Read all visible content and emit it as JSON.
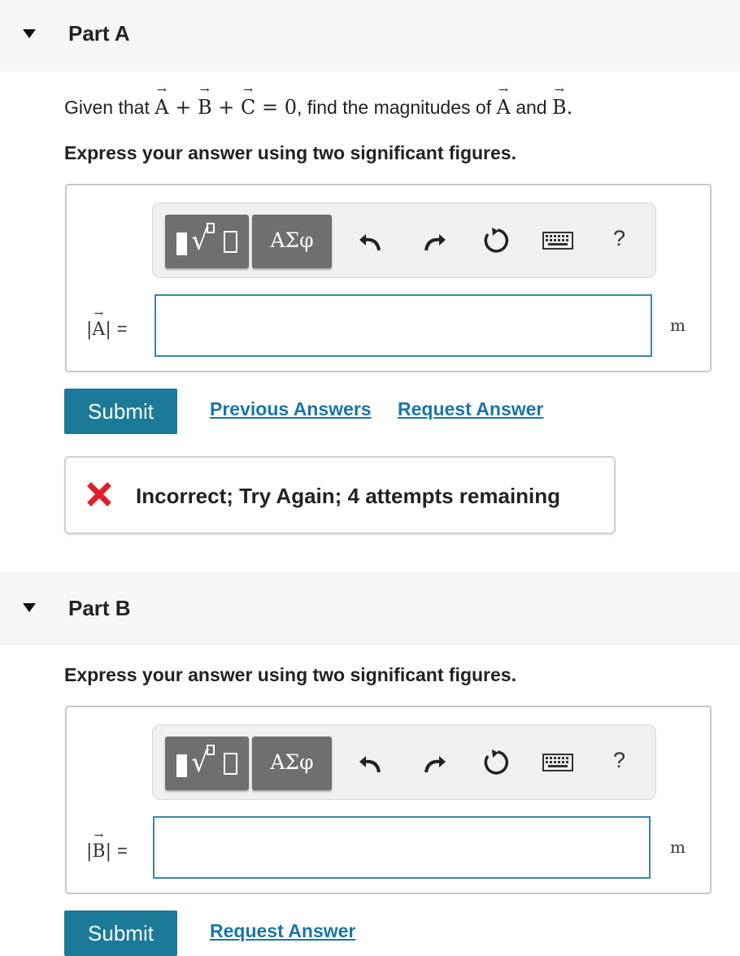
{
  "partA": {
    "title": "Part A",
    "question": {
      "prefix": "Given that ",
      "vecA": "A",
      "plus1": " + ",
      "vecB": "B",
      "plus2": " + ",
      "vecC": "C",
      "equals_zero": " = 0",
      "middle": ", find the magnitudes of ",
      "vecA2": "A",
      "and": " and ",
      "vecB2": "B",
      "end": "."
    },
    "instruction": "Express your answer using two significant figures.",
    "toolbar": {
      "greek_label": "ΑΣφ",
      "help_label": "?"
    },
    "var_label_letter": "A",
    "input_value": "",
    "unit": "m",
    "submit_label": "Submit",
    "previous_answers_label": "Previous Answers",
    "request_answer_label": "Request Answer",
    "feedback": "Incorrect; Try Again; 4 attempts remaining"
  },
  "partB": {
    "title": "Part B",
    "instruction": "Express your answer using two significant figures.",
    "toolbar": {
      "greek_label": "ΑΣφ",
      "help_label": "?"
    },
    "var_label_letter": "B",
    "input_value": "",
    "unit": "m",
    "submit_label": "Submit",
    "request_answer_label": "Request Answer"
  },
  "colors": {
    "accent": "#1b7a98",
    "link": "#1a75a8",
    "error": "#e0202a",
    "input_border": "#3a86a8"
  }
}
